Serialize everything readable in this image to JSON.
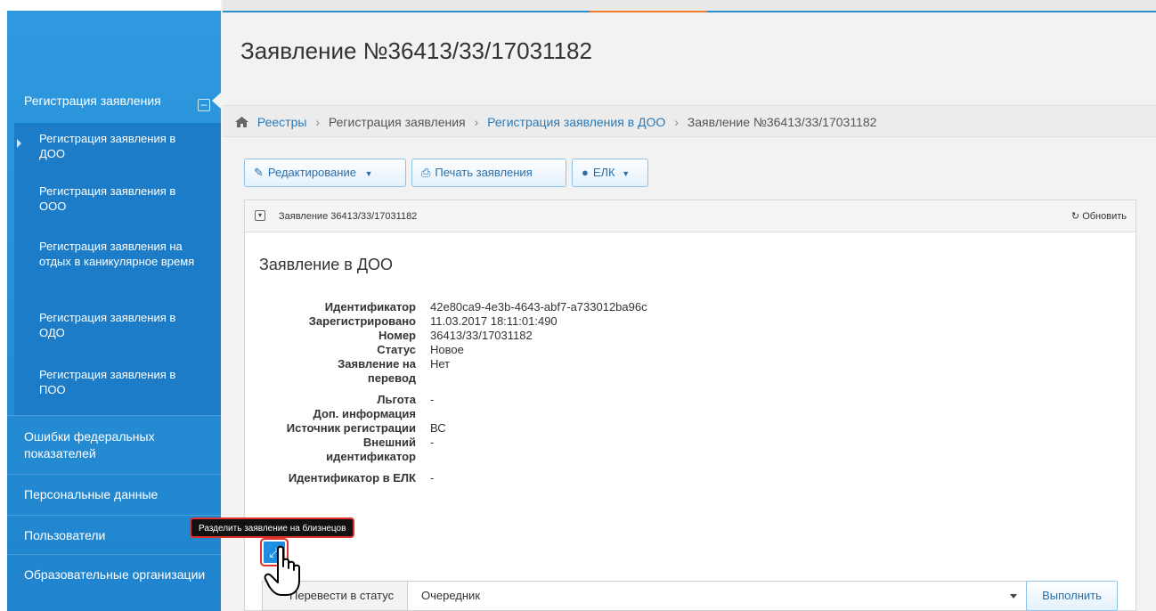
{
  "sidebar": {
    "section_title": "Регистрация заявления",
    "collapse_symbol": "–",
    "sub_items": [
      "Регистрация заявления в ДОО",
      "Регистрация заявления в ООО",
      "Регистрация заявления на отдых в каникулярное время",
      "Регистрация заявления в ОДО",
      "Регистрация заявления в ПОО"
    ],
    "links": [
      "Ошибки федеральных показателей",
      "Персональные данные",
      "Пользователи",
      "Образовательные организации"
    ]
  },
  "page": {
    "title": "Заявление №36413/33/17031182"
  },
  "breadcrumb": {
    "home_icon": "home-icon",
    "items": [
      "Реестры",
      "Регистрация заявления",
      "Регистрация заявления в ДОО",
      "Заявление №36413/33/17031182"
    ]
  },
  "toolbar": {
    "edit_label": "Редактирование",
    "print_label": "Печать заявления",
    "elk_label": "ЕЛК"
  },
  "panel": {
    "title": "Заявление 36413/33/17031182",
    "refresh_label": "Обновить",
    "section_title": "Заявление в ДОО",
    "fields": [
      {
        "key": "Идентификатор",
        "value": "42e80ca9-4e3b-4643-abf7-a733012ba96c"
      },
      {
        "key": "Зарегистрировано",
        "value": "11.03.2017 18:11:01:490"
      },
      {
        "key": "Номер",
        "value": "36413/33/17031182"
      },
      {
        "key": "Статус",
        "value": "Новое"
      },
      {
        "key": "Заявление на перевод",
        "value": "Нет"
      },
      {
        "key": "Льгота",
        "value": "-"
      },
      {
        "key": "Доп. информация",
        "value": ""
      },
      {
        "key": "Источник регистрации",
        "value": "ВС"
      },
      {
        "key": "Внешний идентификатор",
        "value": "-"
      },
      {
        "key": "Идентификатор в ЕЛК",
        "value": "-"
      }
    ]
  },
  "tooltip": {
    "text": "Разделить заявление на близнецов"
  },
  "status": {
    "label": "Перевести в статус",
    "selected": "Очередник",
    "execute_label": "Выполнить"
  },
  "colors": {
    "sidebar": "#2b8fd8",
    "accent": "#2a7ab8",
    "highlight": "#e0322c"
  }
}
